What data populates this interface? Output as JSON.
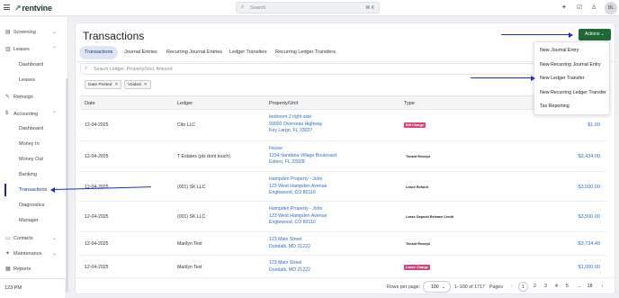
{
  "topbar": {
    "logo": "rentvine",
    "search_placeholder": "Search",
    "search_shortcut": "⌘ K",
    "avatar_initials": "DL"
  },
  "sidebar": {
    "items": [
      {
        "label": "Screening",
        "icon": "screening-icon"
      },
      {
        "label": "Leases",
        "icon": "leases-icon"
      },
      {
        "label": "Remsign",
        "icon": "remsign-icon"
      },
      {
        "label": "Accounting",
        "icon": "accounting-icon"
      },
      {
        "label": "Contacts",
        "icon": "contacts-icon"
      },
      {
        "label": "Maintenance",
        "icon": "maintenance-icon"
      },
      {
        "label": "Reports",
        "icon": "reports-icon"
      }
    ],
    "leases_sub": [
      "Dashboard",
      "Leases"
    ],
    "accounting_sub": [
      "Dashboard",
      "Money In",
      "Money Out",
      "Banking",
      "Transactions",
      "Diagnostics",
      "Manager"
    ],
    "clock": "123 PM"
  },
  "main": {
    "title": "Transactions",
    "actions_label": "Actions",
    "tabs": [
      "Transactions",
      "Journal Entries",
      "Recurring Journal Entries",
      "Ledger Transfers",
      "Recurring Ledger Transfers"
    ],
    "search_placeholder": "Search Ledger, Property/Unit, Amount",
    "filters": [
      "Date Posted",
      "Voided"
    ],
    "columns": [
      "Date",
      "Ledger",
      "Property/Unit",
      "Type"
    ],
    "rows": [
      {
        "date": "12-04-2025",
        "ledger": "Cito LLC",
        "prop": [
          "bedroom 2 right side",
          "99000 Overseas Highway",
          "Key Largo, FL 33037"
        ],
        "type": "Bill Charge",
        "amount": "$1.00"
      },
      {
        "date": "12-04-2025",
        "ledger": "T Estates (pls dont touch)",
        "prop": [
          "House",
          "1234 Vandana Village Boulevard",
          "Estero, FL 33928"
        ],
        "type": "Tenant Receipt",
        "amount": "$2,434.00"
      },
      {
        "date": "12-04-2025",
        "ledger": "(001) SK LLC",
        "prop": [
          "Hampden Property - John",
          "123 West Hampden Avenue",
          "Englewood, CO 80110"
        ],
        "type": "Lease Refund",
        "amount": "$3,500.00"
      },
      {
        "date": "12-04-2025",
        "ledger": "(001) SK LLC",
        "prop": [
          "Hampden Property - John",
          "123 West Hampden Avenue",
          "Englewood, CO 80110"
        ],
        "type": "Lease Deposit Release Credit",
        "amount": "$3,500.00"
      },
      {
        "date": "12-04-2025",
        "ledger": "Marilyn Test",
        "prop": [
          "123 Main Street",
          "Dundalk, MD 21222"
        ],
        "type": "Tenant Receipt",
        "amount": "$3,734.40"
      },
      {
        "date": "12-04-2025",
        "ledger": "Marilyn Test",
        "prop": [
          "123 Main Street",
          "Dundalk, MD 21222"
        ],
        "type": "Lease Charge",
        "amount": "$1,000.00"
      }
    ],
    "pager": {
      "rows_per_page_label": "Rows per page:",
      "rows_per_page": "100",
      "range": "1–100 of 1717",
      "pages_label": "Pages",
      "pages": [
        "1",
        "2",
        "3",
        "4",
        "5",
        "...",
        "18"
      ]
    }
  },
  "dropdown": {
    "items": [
      "New Journal Entry",
      "New Recurring Journal Entry",
      "New Ledger Transfer",
      "New Recurring Ledger Transfer",
      "Tax Reporting"
    ]
  },
  "colors": {
    "accent_green": "#1f6a34",
    "link_blue": "#2a6fc9",
    "annotation_arrow": "#1a2fd4",
    "badge_pink": "#d1447c"
  }
}
